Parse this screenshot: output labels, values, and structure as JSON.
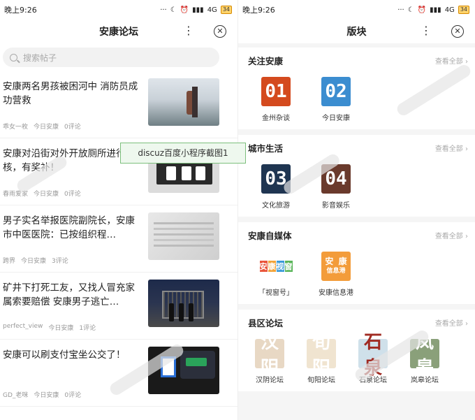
{
  "tooltip": "discuz百度小程序截图1",
  "status": {
    "time": "晚上9:26",
    "network": "4G",
    "battery": "34"
  },
  "left": {
    "title": "安康论坛",
    "search_placeholder": "搜索帖子",
    "posts": [
      {
        "title": "安康两名男孩被困河中 消防员成功营救",
        "author": "乖女一枚",
        "forum": "今日安康",
        "comments": "0评论"
      },
      {
        "title": "安康对沿街对外开放厕所进行考核，有奖补！",
        "author": "春雨爱家",
        "forum": "今日安康",
        "comments": "0评论"
      },
      {
        "title": "男子实名举报医院副院长，安康市中医医院：已按组织程…",
        "author": "跨界",
        "forum": "今日安康",
        "comments": "3评论"
      },
      {
        "title": "矿井下打死工友，又找人冒充家属索要赔偿 安康男子逃亡…",
        "author": "perfect_view",
        "forum": "今日安康",
        "comments": "1评论"
      },
      {
        "title": "安康可以刷支付宝坐公交了！",
        "author": "GD_老咪",
        "forum": "今日安康",
        "comments": "0评论"
      }
    ]
  },
  "right": {
    "title": "版块",
    "view_all": "查看全部",
    "sections": [
      {
        "name": "关注安康",
        "tiles": [
          {
            "icon_text": "01",
            "label": "金州杂谈",
            "color": "#d44a1e"
          },
          {
            "icon_text": "02",
            "label": "今日安康",
            "color": "#3b8dd0"
          }
        ]
      },
      {
        "name": "城市生活",
        "tiles": [
          {
            "icon_text": "03",
            "label": "文化旅游",
            "color": "#1f3551"
          },
          {
            "icon_text": "04",
            "label": "影音娱乐",
            "color": "#6a3a2c"
          }
        ]
      },
      {
        "name": "安康自媒体",
        "tiles": [
          {
            "icon_text": "安康视窗",
            "label": "「视窗号」"
          },
          {
            "icon_text": "安康信息港",
            "label": "安康信息港",
            "color": "#f39c3a"
          }
        ]
      },
      {
        "name": "县区论坛",
        "tiles": [
          {
            "icon_text": "汉阴",
            "label": "汉阴论坛"
          },
          {
            "icon_text": "旬阳",
            "label": "旬阳论坛"
          },
          {
            "icon_text": "石泉",
            "label": "石泉论坛"
          },
          {
            "icon_text": "岚皋",
            "label": "岚皋论坛"
          }
        ]
      }
    ]
  }
}
